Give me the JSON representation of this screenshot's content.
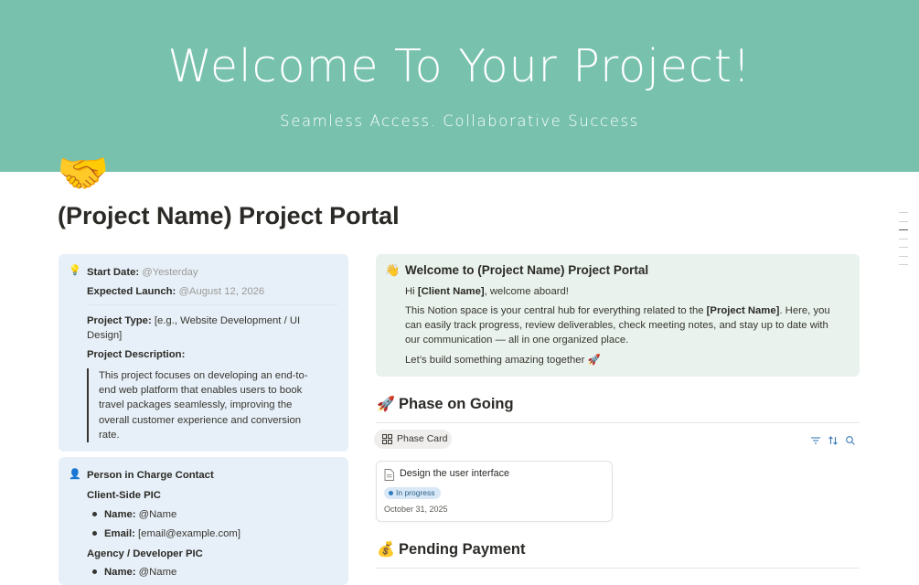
{
  "cover": {
    "title": "Welcome To Your Project!",
    "subtitle": "Seamless Access. Collaborative Success",
    "background": "#78c2ad"
  },
  "page": {
    "icon": "🤝",
    "title": "(Project Name) Project Portal"
  },
  "info_callout": {
    "icon": "💡",
    "start_label": "Start Date:",
    "start_value": "@Yesterday",
    "launch_label": "Expected Launch:",
    "launch_value": "@August 12, 2026",
    "type_label": "Project Type:",
    "type_value": "[e.g., Website Development / UI Design]",
    "desc_label": "Project Description:",
    "desc_value": "This project focuses on developing an end-to-end web platform that enables users to book travel packages seamlessly, improving the overall customer experience and conversion rate."
  },
  "contact_callout": {
    "icon": "👤",
    "title": "Person in Charge Contact",
    "client_heading": "Client-Side PIC",
    "client_name_label": "Name:",
    "client_name_value": "@Name",
    "client_email_label": "Email:",
    "client_email_value": "[email@example.com]",
    "agency_heading": "Agency / Developer PIC",
    "agency_name_label": "Name:",
    "agency_name_value": "@Name"
  },
  "welcome_callout": {
    "icon": "👋",
    "title": "Welcome to (Project Name) Project Portal",
    "greeting_pre": "Hi ",
    "greeting_bold": "[Client Name]",
    "greeting_post": ", welcome aboard!",
    "body_pre": "This Notion space is your central hub for everything related to the ",
    "body_bold": "[Project Name]",
    "body_post": ". Here, you can easily track progress, review deliverables, check meeting notes, and stay up to date with our communication — all in one organized place.",
    "closing": "Let’s build something amazing together 🚀"
  },
  "phase_section": {
    "icon": "🚀",
    "title": "Phase on Going",
    "view_label": "Phase Card",
    "toolbar_icons": [
      "filter-icon",
      "sort-icon",
      "search-icon"
    ],
    "card": {
      "title": "Design the user interface",
      "status": "In progress",
      "date": "October 31, 2025"
    }
  },
  "payment_section": {
    "icon": "💰",
    "title": "Pending Payment"
  },
  "colors": {
    "accent": "#78c2ad",
    "callout_blue": "#e7f0f8",
    "callout_green": "#e9f2ec",
    "status_blue": "#2e7bc0"
  }
}
